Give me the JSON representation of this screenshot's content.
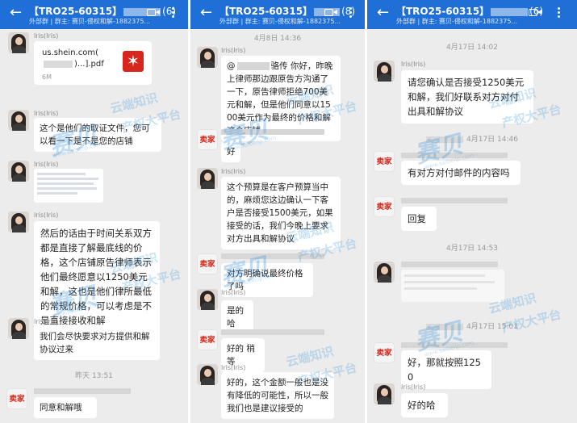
{
  "panels": [
    {
      "header": {
        "title_prefix": "【TRO25-60315】",
        "count": "(6)",
        "subtitle": "外部群 | 群主: 赛贝-侵权和解-1882375..."
      },
      "file": {
        "name_line1": "us.shein.com(",
        "name_line2": ")...].pdf",
        "size": "6M",
        "icon": "pdf-icon"
      },
      "sender": "Iris(Iris)",
      "messages": [
        "这个是他们的取证文件，您可以看一下是不是您的店铺",
        "然后的话由于时间关系双方都是直接了解最底线的价格，这个店铺原告律师表示他们最终愿意以1250美元和解，这也是他们律所最低的常规价格，可以考虑是不是直接接收和解",
        "我们会尽快要求对方提供和解协议过来",
        "同意和解哦"
      ],
      "timestamp": "昨天 13:51",
      "seller_avatar": "卖家"
    },
    {
      "header": {
        "title_prefix": "【TRO25-60315】",
        "count": "(8)",
        "subtitle": "外部群 | 群主: 赛贝-侵权和解-1882375..."
      },
      "timestamp": "4月8日 14:36",
      "sender": "Iris(Iris)",
      "messages": [
        "骆传 你好，昨晚上律师那边跟原告方沟通了一下，原告律师拒绝700美元和解，但是他们同意以1500美元作为最终的价格和解这个店铺",
        "好",
        "这个预算是在客户预算当中的，麻烦您这边确认一下客户是否接受1500美元，如果接受的话，我们今晚上要求对方出具和解协议",
        "对方明确说最终价格了吗",
        "是的哈",
        "好的 稍等",
        "好的，这个金额一般也是没有降低的可能性，所以一般我们也是建议接受的"
      ],
      "seller_avatar": "卖家"
    },
    {
      "header": {
        "title_prefix": "【TRO25-60315】",
        "count": "(6)",
        "subtitle": "外部群 | 群主: 赛贝-侵权和解-1882375..."
      },
      "timestamps": [
        "4月17日 14:02",
        "4月17日 14:46",
        "4月17日 14:53",
        "4月17日 15:01"
      ],
      "sender": "Iris(Iris)",
      "messages": [
        "请您确认是否接受1250美元和解，我们好联系对方对付出具和解协议",
        "有对方对付邮件的内容吗",
        "回复",
        "好，那就按照1250",
        "好的哈"
      ],
      "seller_avatar": "卖家"
    }
  ],
  "watermark": {
    "logo": "赛贝",
    "line1": "云端知识",
    "line2": "产权大平台",
    "url": "www.saibeiip.com"
  },
  "colors": {
    "header": "#1f6fd6",
    "chat_bg": "#ececec",
    "bubble": "#ffffff",
    "seller_red": "#d5281c",
    "watermark": "#3c96dc"
  }
}
